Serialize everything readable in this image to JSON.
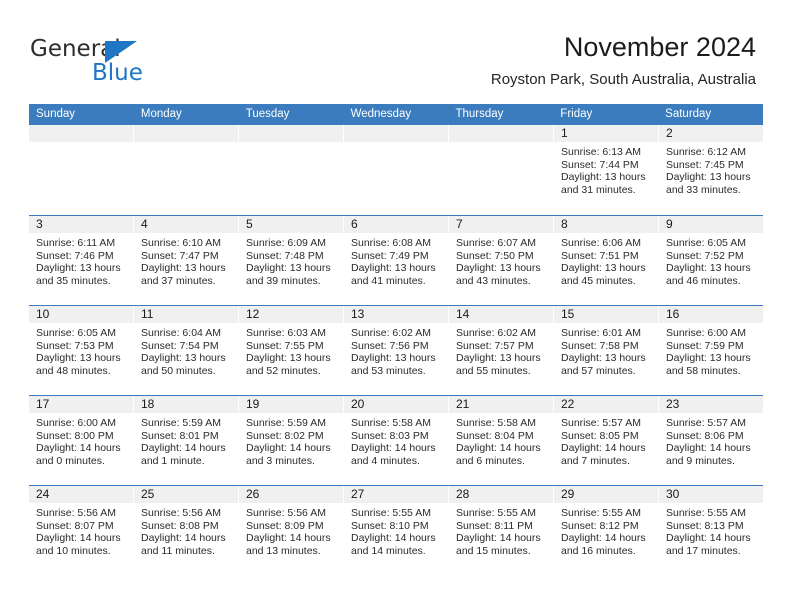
{
  "brand": {
    "name_part1": "General",
    "name_part2": "Blue",
    "triangle_color": "#1e76c4"
  },
  "header": {
    "title": "November 2024",
    "subtitle": "Royston Park, South Australia, Australia"
  },
  "theme": {
    "header_blue": "#3a7cbe",
    "daynum_band": "#f0f0f0",
    "text": "#2b2b2b"
  },
  "calendar": {
    "weekday_headers": [
      "Sunday",
      "Monday",
      "Tuesday",
      "Wednesday",
      "Thursday",
      "Friday",
      "Saturday"
    ],
    "labels": {
      "sunrise": "Sunrise:",
      "sunset": "Sunset:",
      "daylight": "Daylight:"
    },
    "weeks": [
      [
        {
          "day": "",
          "empty": true
        },
        {
          "day": "",
          "empty": true
        },
        {
          "day": "",
          "empty": true
        },
        {
          "day": "",
          "empty": true
        },
        {
          "day": "",
          "empty": true
        },
        {
          "day": "1",
          "sunrise": "Sunrise: 6:13 AM",
          "sunset": "Sunset: 7:44 PM",
          "daylight1": "Daylight: 13 hours",
          "daylight2": "and 31 minutes."
        },
        {
          "day": "2",
          "sunrise": "Sunrise: 6:12 AM",
          "sunset": "Sunset: 7:45 PM",
          "daylight1": "Daylight: 13 hours",
          "daylight2": "and 33 minutes."
        }
      ],
      [
        {
          "day": "3",
          "sunrise": "Sunrise: 6:11 AM",
          "sunset": "Sunset: 7:46 PM",
          "daylight1": "Daylight: 13 hours",
          "daylight2": "and 35 minutes."
        },
        {
          "day": "4",
          "sunrise": "Sunrise: 6:10 AM",
          "sunset": "Sunset: 7:47 PM",
          "daylight1": "Daylight: 13 hours",
          "daylight2": "and 37 minutes."
        },
        {
          "day": "5",
          "sunrise": "Sunrise: 6:09 AM",
          "sunset": "Sunset: 7:48 PM",
          "daylight1": "Daylight: 13 hours",
          "daylight2": "and 39 minutes."
        },
        {
          "day": "6",
          "sunrise": "Sunrise: 6:08 AM",
          "sunset": "Sunset: 7:49 PM",
          "daylight1": "Daylight: 13 hours",
          "daylight2": "and 41 minutes."
        },
        {
          "day": "7",
          "sunrise": "Sunrise: 6:07 AM",
          "sunset": "Sunset: 7:50 PM",
          "daylight1": "Daylight: 13 hours",
          "daylight2": "and 43 minutes."
        },
        {
          "day": "8",
          "sunrise": "Sunrise: 6:06 AM",
          "sunset": "Sunset: 7:51 PM",
          "daylight1": "Daylight: 13 hours",
          "daylight2": "and 45 minutes."
        },
        {
          "day": "9",
          "sunrise": "Sunrise: 6:05 AM",
          "sunset": "Sunset: 7:52 PM",
          "daylight1": "Daylight: 13 hours",
          "daylight2": "and 46 minutes."
        }
      ],
      [
        {
          "day": "10",
          "sunrise": "Sunrise: 6:05 AM",
          "sunset": "Sunset: 7:53 PM",
          "daylight1": "Daylight: 13 hours",
          "daylight2": "and 48 minutes."
        },
        {
          "day": "11",
          "sunrise": "Sunrise: 6:04 AM",
          "sunset": "Sunset: 7:54 PM",
          "daylight1": "Daylight: 13 hours",
          "daylight2": "and 50 minutes."
        },
        {
          "day": "12",
          "sunrise": "Sunrise: 6:03 AM",
          "sunset": "Sunset: 7:55 PM",
          "daylight1": "Daylight: 13 hours",
          "daylight2": "and 52 minutes."
        },
        {
          "day": "13",
          "sunrise": "Sunrise: 6:02 AM",
          "sunset": "Sunset: 7:56 PM",
          "daylight1": "Daylight: 13 hours",
          "daylight2": "and 53 minutes."
        },
        {
          "day": "14",
          "sunrise": "Sunrise: 6:02 AM",
          "sunset": "Sunset: 7:57 PM",
          "daylight1": "Daylight: 13 hours",
          "daylight2": "and 55 minutes."
        },
        {
          "day": "15",
          "sunrise": "Sunrise: 6:01 AM",
          "sunset": "Sunset: 7:58 PM",
          "daylight1": "Daylight: 13 hours",
          "daylight2": "and 57 minutes."
        },
        {
          "day": "16",
          "sunrise": "Sunrise: 6:00 AM",
          "sunset": "Sunset: 7:59 PM",
          "daylight1": "Daylight: 13 hours",
          "daylight2": "and 58 minutes."
        }
      ],
      [
        {
          "day": "17",
          "sunrise": "Sunrise: 6:00 AM",
          "sunset": "Sunset: 8:00 PM",
          "daylight1": "Daylight: 14 hours",
          "daylight2": "and 0 minutes."
        },
        {
          "day": "18",
          "sunrise": "Sunrise: 5:59 AM",
          "sunset": "Sunset: 8:01 PM",
          "daylight1": "Daylight: 14 hours",
          "daylight2": "and 1 minute."
        },
        {
          "day": "19",
          "sunrise": "Sunrise: 5:59 AM",
          "sunset": "Sunset: 8:02 PM",
          "daylight1": "Daylight: 14 hours",
          "daylight2": "and 3 minutes."
        },
        {
          "day": "20",
          "sunrise": "Sunrise: 5:58 AM",
          "sunset": "Sunset: 8:03 PM",
          "daylight1": "Daylight: 14 hours",
          "daylight2": "and 4 minutes."
        },
        {
          "day": "21",
          "sunrise": "Sunrise: 5:58 AM",
          "sunset": "Sunset: 8:04 PM",
          "daylight1": "Daylight: 14 hours",
          "daylight2": "and 6 minutes."
        },
        {
          "day": "22",
          "sunrise": "Sunrise: 5:57 AM",
          "sunset": "Sunset: 8:05 PM",
          "daylight1": "Daylight: 14 hours",
          "daylight2": "and 7 minutes."
        },
        {
          "day": "23",
          "sunrise": "Sunrise: 5:57 AM",
          "sunset": "Sunset: 8:06 PM",
          "daylight1": "Daylight: 14 hours",
          "daylight2": "and 9 minutes."
        }
      ],
      [
        {
          "day": "24",
          "sunrise": "Sunrise: 5:56 AM",
          "sunset": "Sunset: 8:07 PM",
          "daylight1": "Daylight: 14 hours",
          "daylight2": "and 10 minutes."
        },
        {
          "day": "25",
          "sunrise": "Sunrise: 5:56 AM",
          "sunset": "Sunset: 8:08 PM",
          "daylight1": "Daylight: 14 hours",
          "daylight2": "and 11 minutes."
        },
        {
          "day": "26",
          "sunrise": "Sunrise: 5:56 AM",
          "sunset": "Sunset: 8:09 PM",
          "daylight1": "Daylight: 14 hours",
          "daylight2": "and 13 minutes."
        },
        {
          "day": "27",
          "sunrise": "Sunrise: 5:55 AM",
          "sunset": "Sunset: 8:10 PM",
          "daylight1": "Daylight: 14 hours",
          "daylight2": "and 14 minutes."
        },
        {
          "day": "28",
          "sunrise": "Sunrise: 5:55 AM",
          "sunset": "Sunset: 8:11 PM",
          "daylight1": "Daylight: 14 hours",
          "daylight2": "and 15 minutes."
        },
        {
          "day": "29",
          "sunrise": "Sunrise: 5:55 AM",
          "sunset": "Sunset: 8:12 PM",
          "daylight1": "Daylight: 14 hours",
          "daylight2": "and 16 minutes."
        },
        {
          "day": "30",
          "sunrise": "Sunrise: 5:55 AM",
          "sunset": "Sunset: 8:13 PM",
          "daylight1": "Daylight: 14 hours",
          "daylight2": "and 17 minutes."
        }
      ]
    ]
  }
}
